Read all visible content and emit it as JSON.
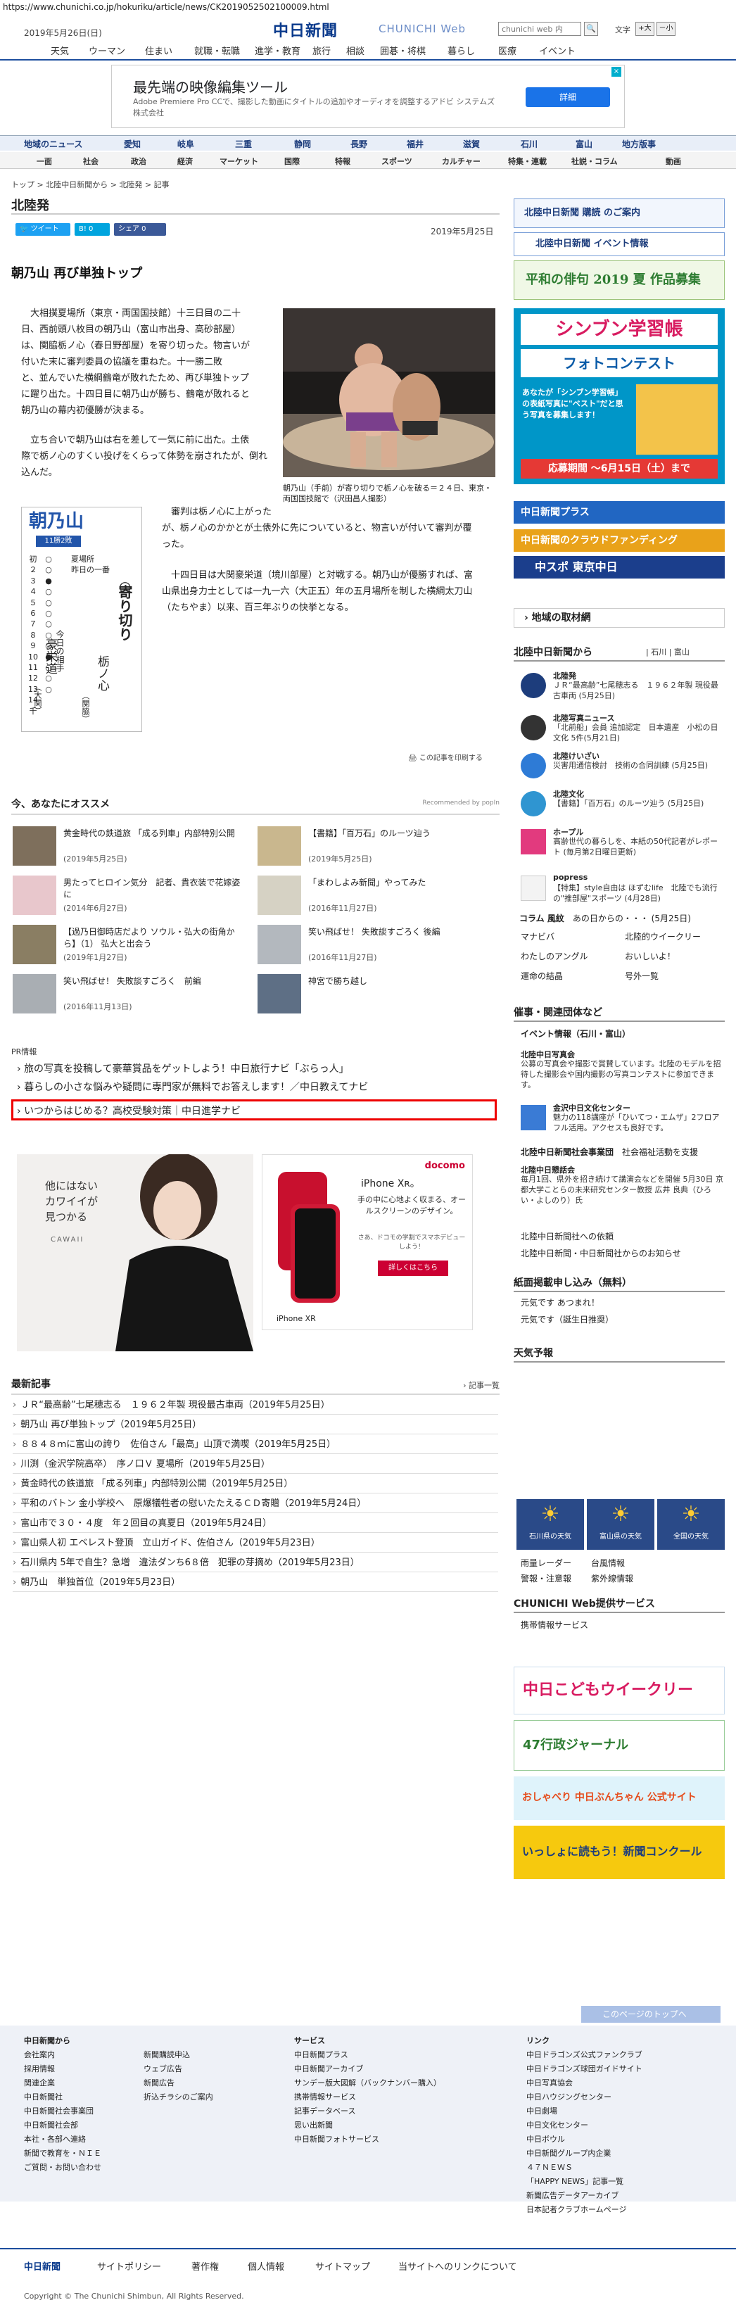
{
  "url": "https://www.chunichi.co.jp/hokuriku/article/news/CK2019052502100009.html",
  "header": {
    "date": "2019年5月26日(日)",
    "logo": "中日新聞",
    "logo_sub": "CHUNICHI Web",
    "search_placeholder": "chunichi web 内",
    "font_size_label": "文字",
    "font_large": "+大",
    "font_small": "－小"
  },
  "nav_top": [
    "天気",
    "ウーマン",
    "住まい",
    "就職・転職",
    "進学・教育",
    "旅行",
    "相談",
    "囲碁・将棋",
    "暮らし",
    "医療",
    "イベント"
  ],
  "ad_top": {
    "title": "最先端の映像編集ツール",
    "desc": "Adobe Premiere Pro CCで、撮影した動画にタイトルの追加やオーディオを調整するアドビ システムズ株式会社",
    "button": "詳細"
  },
  "nav_region": [
    "地域のニュース",
    "愛知",
    "岐阜",
    "三重",
    "静岡",
    "長野",
    "福井",
    "滋賀",
    "石川",
    "富山",
    "地方版事"
  ],
  "nav_genre": [
    "一面",
    "社会",
    "政治",
    "経済",
    "マーケット",
    "国際",
    "特報",
    "スポーツ",
    "カルチャー",
    "特集・連載",
    "社説・コラム",
    "動画"
  ],
  "breadcrumb": "トップ > 北陸中日新聞から > 北陸発 > 記事",
  "section_title": "北陸発",
  "share": {
    "tweet": "ツイート",
    "hatena": "B! 0",
    "facebook": "シェア 0"
  },
  "pub_date": "2019年5月25日",
  "article": {
    "title": "朝乃山 再び単独トップ",
    "p1": [
      "　大相撲夏場所（東京・両国国技館）十三日目の二十",
      "日、西前頭八枚目の朝乃山（富山市出身、高砂部屋）",
      "は、関脇栃ノ心（春日野部屋）を寄り切った。物言いが",
      "付いた末に審判委員の協議を重ねた。十一勝二敗",
      "と、並んでいた横綱鶴竜が敗れたため、再び単独トップ",
      "に躍り出た。十四日目に朝乃山が勝ち、鶴竜が敗れると",
      "朝乃山の幕内初優勝が決まる。"
    ],
    "p2": [
      "　立ち合いで朝乃山は右を差して一気に前に出た。土俵",
      "際で栃ノ心のすくい投げをくらって体勢を崩されたが、倒れ",
      "込んだ。"
    ],
    "p3": [
      "　審判は栃ノ心に上がった",
      "が、栃ノ心のかかとが土俵外に先についていると、物言いが付いて審判が覆",
      "った。"
    ],
    "p4": [
      "　十四日目は大関豪栄道（境川部屋）と対戦する。朝乃山が優勝すれば、富",
      "山県出身力士としては一九一六（大正五）年の五月場所を制した横綱太刀山",
      "（たちやま）以来、百三年ぶりの快挙となる。"
    ],
    "caption": "朝乃山（手前）が寄り切りで栃ノ心を破る＝２４日、東京・両国国技館で（沢田昌人撮影）",
    "correction": "この記事を印刷する"
  },
  "card": {
    "name": "朝乃山",
    "record": "11勝2敗",
    "basho_label": "夏場所",
    "prev_label": "昨日の一番",
    "days": [
      "初",
      "２",
      "３",
      "４",
      "５",
      "６",
      "７",
      "８",
      "９",
      "10",
      "11",
      "12",
      "13",
      "14",
      "千"
    ],
    "results": [
      "○",
      "○",
      "●",
      "○",
      "○",
      "○",
      "○",
      "○",
      "○",
      "●",
      "○",
      "○",
      "○",
      "",
      ""
    ],
    "kimarite": "寄り切り",
    "opponent": "栃ノ心",
    "opponent_note": "（関脇）",
    "today_label": "今日の相手",
    "today_opponent": "豪栄道",
    "today_note": "（大関）"
  },
  "recommend": {
    "title": "今、あなたにオススメ",
    "powered": "Recommended by popIn",
    "items": [
      {
        "title": "黄金時代の鉄道旅 「成る列車」内部特別公開",
        "date": "(2019年5月25日)"
      },
      {
        "title": "【書籍】「百万石」のルーツ辿う",
        "date": "(2019年5月25日)"
      },
      {
        "title": "男たってヒロイン気分　記者、貴衣装で花嫁姿に",
        "date": "(2014年6月27日)"
      },
      {
        "title": "「まわしよみ新聞」やってみた",
        "date": "(2016年11月27日)"
      },
      {
        "title": "【過乃日御時店だより ソウル・弘大の街角から】（1） 弘大と出会う",
        "date": "(2019年1月27日)"
      },
      {
        "title": "笑い飛ばせ！ 失敗談すごろく 後編",
        "date": "(2016年11月27日)"
      },
      {
        "title": "笑い飛ばせ！ 失敗談すごろく　前編",
        "date": "(2016年11月13日)"
      },
      {
        "title": "神宮で勝ち越し",
        "date": ""
      }
    ]
  },
  "pr": {
    "label": "PR情報",
    "items": [
      "旅の写真を投稿して豪華賞品をゲットしよう！中日旅行ナビ「ぶらっ人」",
      "暮らしの小さな悩みや疑問に専門家が無料でお答えします！／中日教えてナビ",
      "いつからはじめる？高校受験対策｜中日進学ナビ"
    ]
  },
  "ad_left": {
    "text": "他にはない\nカワイイが\n見つかる",
    "brand": "CAWAII"
  },
  "ad_right": {
    "brand": "docomo",
    "title": "iPhone Xʀ。",
    "desc": "手の中に心地よく収まる、オールスクリーンのデザイン。",
    "sub": "さあ、ドコモの学割でスマホデビューしよう！",
    "button": "詳しくはこちら",
    "model": "iPhone XR"
  },
  "latest": {
    "title": "最新記事",
    "more": "記事一覧",
    "items": [
      "ＪＲ“最高齢”七尾穂志る　１９６２年製 現役最古車両（2019年5月25日）",
      "朝乃山 再び単独トップ（2019年5月25日）",
      "８８４８ｍに富山の誇り　佐伯さん「最高」山頂で満喫（2019年5月25日）",
      "川渕（金沢学院高卒）　序ノ口Ｖ 夏場所（2019年5月25日）",
      "黄金時代の鉄道旅 「成る列車」内部特別公開（2019年5月25日）",
      "平和のバトン 金小学校へ　原爆犠牲者の慰いたたえるＣＤ寄贈（2019年5月24日）",
      "富山市で３０・４度　年２回目の真夏日（2019年5月24日）",
      "富山県人初 エベレスト登頂　立山ガイド、佐伯さん（2019年5月23日）",
      "石川県内 5年で自生？急増　違法ダンち6８倍　犯罪の芽摘め（2019年5月23日）",
      "朝乃山　単独首位（2019年5月23日）"
    ]
  },
  "right": {
    "subscribe": "北陸中日新聞 購読 のご案内",
    "event": "北陸中日新聞 イベント情報",
    "haiku": "平和の俳句 2019 夏 作品募集",
    "contest_title": "シンブン学習帳",
    "contest_sub": "フォトコンテスト",
    "contest_body": "あなたが「シンブン学習帳」の表紙写真に\"ベスト\"だと思う写真を募集します！",
    "contest_deadline": "応募期間 ～6月15日（土）まで",
    "plus": "中日新聞プラス",
    "crowd": "中日新聞のクラウドファンディング",
    "chuspo": "中スポ 東京中日",
    "local_link": "地域の取材網",
    "hokuriku_title": "北陸中日新聞から",
    "hokuriku_tabs": "| 石川 | 富山",
    "hokuriku_items": [
      {
        "head": "北陸発",
        "body": "ＪＲ“最高齢”七尾穂志る　１９６２年製 現役最古車両 (5月25日)"
      },
      {
        "head": "北陸写真ニュース",
        "body": "「北前船」会員 追加認定　日本遺産　小松の日文化 5件(5月21日)"
      },
      {
        "head": "北陸けいざい",
        "body": "災害用通信検討　技術の合同訓練 (5月25日)"
      },
      {
        "head": "北陸文化",
        "body": "【書籍】「百万石」のルーツ辿う (5月25日)"
      },
      {
        "head": "ホープル",
        "body": "高齢世代の暮らしを、本紙の50代記者がレポート (毎月第2日曜日更新)"
      },
      {
        "head": "popress",
        "body": "【特集】style自由は ほずむlife　北陸でも流行の\"推部屋\"スポーツ (4月28日)"
      }
    ],
    "column_label": "コラム 風紋",
    "column_text": "あの日からの・・・ (5月25日)",
    "links": [
      "マナビバ",
      "北陸的ウイークリー",
      "わたしのアングル",
      "おいしいよ！",
      "運命の結晶",
      "号外一覧"
    ],
    "saiyo_title": "催事・関連団体など",
    "saiyo_sub": "イベント情報（石川・富山）",
    "saiyo_items": [
      {
        "head": "北陸中日写真会",
        "body": "公募の写真会や撮影で賞賛しています。北陸のモデルを招待した撮影会や国内撮影の写真コンテストに参加できます。"
      },
      {
        "head": "金沢中日文化センター",
        "body": "魅力の118講座が「ひいてつ・エムザ」2フロアフル活用。アクセスも良好です。"
      },
      {
        "head": "北陸中日新聞社会事業団",
        "body": "社会福祉活動を支援"
      },
      {
        "head": "北陸中日懇話会",
        "body": "毎月1回、県外を招き続けて講演会などを開催 5月30日 京都大学ことらの未来研究センター教授 広井 良典（ひろい・よしのり）氏"
      }
    ],
    "saiyo_more1": "北陸中日新聞社への依頼",
    "saiyo_more2": "北陸中日新聞・中日新聞社からのお知らせ",
    "keisai_title": "紙面掲載申し込み（無料）",
    "keisai_items": [
      "元気です あつまれ！",
      "元気です（誕生日推奨）"
    ],
    "weather_title": "天気予報",
    "weather": [
      "石川県の天気",
      "富山県の天気",
      "全国の天気"
    ],
    "weather_links": [
      "雨量レーダー",
      "台風情報",
      "警報・注意報",
      "紫外線情報"
    ],
    "svc_title": "CHUNICHI Web提供サービス",
    "svc_item": "携帯情報サービス",
    "banners": [
      "中日こどもウイークリー",
      "47行政ジャーナル",
      "おしゃべり 中日ぶんちゃん 公式サイト",
      "いっしょに読もう！新聞コンクール"
    ],
    "top_link": "このページのトップへ"
  },
  "footer": {
    "col1_title": "中日新聞から",
    "col1": [
      "会社案内",
      "採用情報",
      "関連企業",
      "中日新聞社",
      "中日新聞社会事業団",
      "中日新聞社会部",
      "本社・各部へ連絡",
      "新聞で教育を・ＮＩＥ",
      "ご質問・お問い合わせ"
    ],
    "col2": [
      "新聞購読申込",
      "ウェブ広告",
      "新聞広告",
      "折込チラシのご案内"
    ],
    "col3_title": "サービス",
    "col3": [
      "中日新聞プラス",
      "中日新聞アーカイブ",
      "サンデー版大図解（バックナンバー購入）",
      "携帯情報サービス",
      "記事データベース",
      "思い出新聞",
      "中日新聞フォトサービス"
    ],
    "col4_title": "リンク",
    "col4": [
      "中日ドラゴンズ公式ファンクラブ",
      "中日ドラゴンズ球団ガイドサイト",
      "中日写真協会",
      "中日ハウジングセンター",
      "中日劇場",
      "中日文化センター",
      "中日ボウル",
      "中日新聞グループ内企業",
      "４７ＮＥＷＳ",
      "「HAPPY NEWS」記事一覧",
      "新聞広告データアーカイブ",
      "日本記者クラブホームページ"
    ],
    "bar": [
      "中日新聞",
      "サイトポリシー",
      "著作権",
      "個人情報",
      "サイトマップ",
      "当サイトへのリンクについて"
    ],
    "copyright": "Copyright © The Chunichi Shimbun, All Rights Reserved."
  }
}
